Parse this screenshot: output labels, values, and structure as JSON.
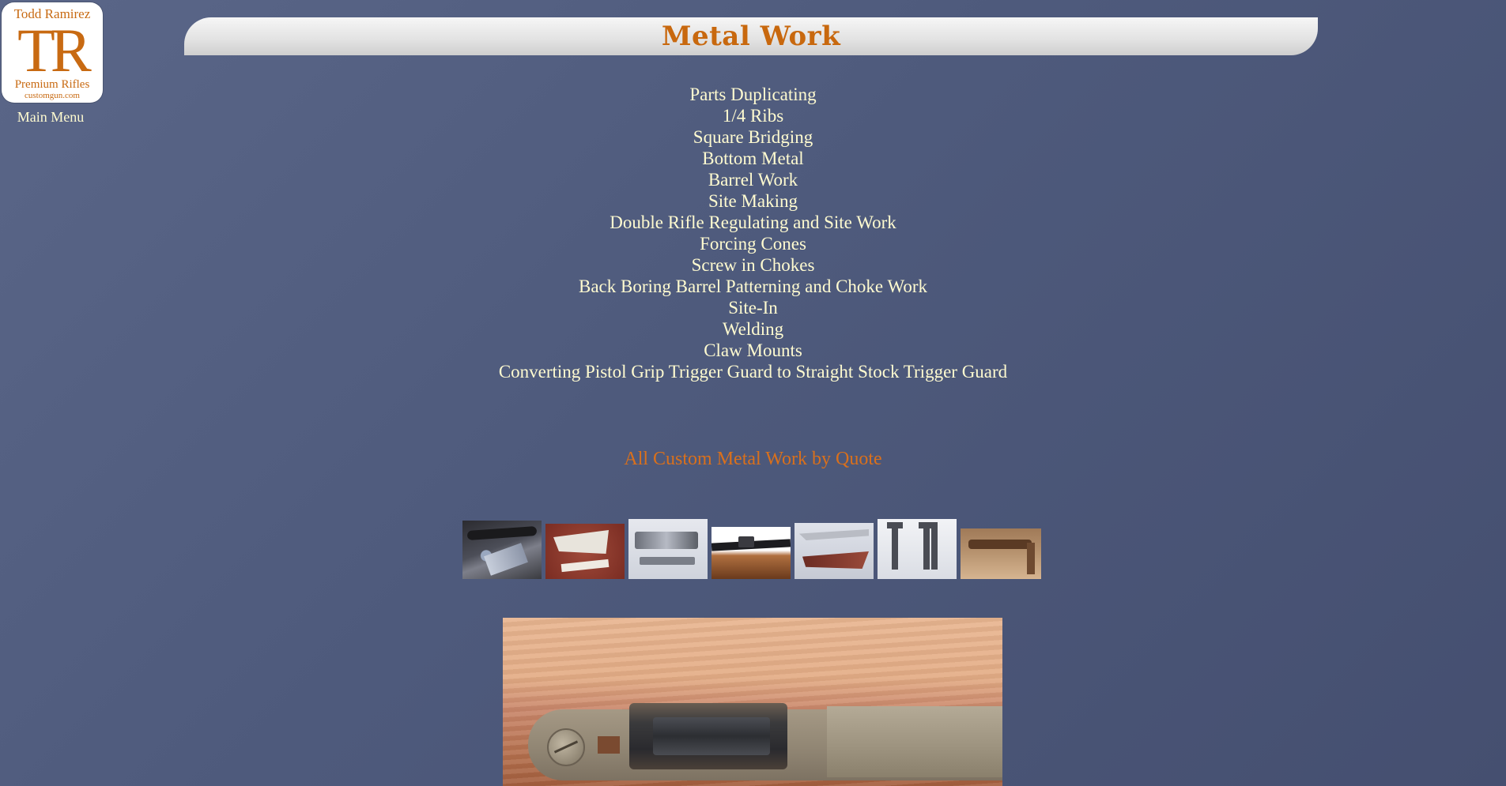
{
  "logo": {
    "top_text": "Todd Ramirez",
    "monogram": "TR",
    "sub_text": "Premium Rifles",
    "url_text": "customgun.com"
  },
  "nav": {
    "main_menu": "Main Menu"
  },
  "page": {
    "title": "Metal Work"
  },
  "services": [
    "Parts Duplicating",
    "1/4 Ribs",
    "Square Bridging",
    "Bottom Metal",
    "Barrel Work",
    "Site Making",
    "Double Rifle Regulating and Site Work",
    "Forcing Cones",
    "Screw in Chokes",
    "Back Boring Barrel Patterning and Choke Work",
    "Site-In",
    "Welding",
    "Claw Mounts",
    "Converting Pistol Grip Trigger Guard to Straight Stock Trigger Guard"
  ],
  "quote": "All Custom Metal Work by Quote",
  "colors": {
    "accent": "#c8680e",
    "link": "#fffbd0",
    "background": "#4e5a7c"
  }
}
